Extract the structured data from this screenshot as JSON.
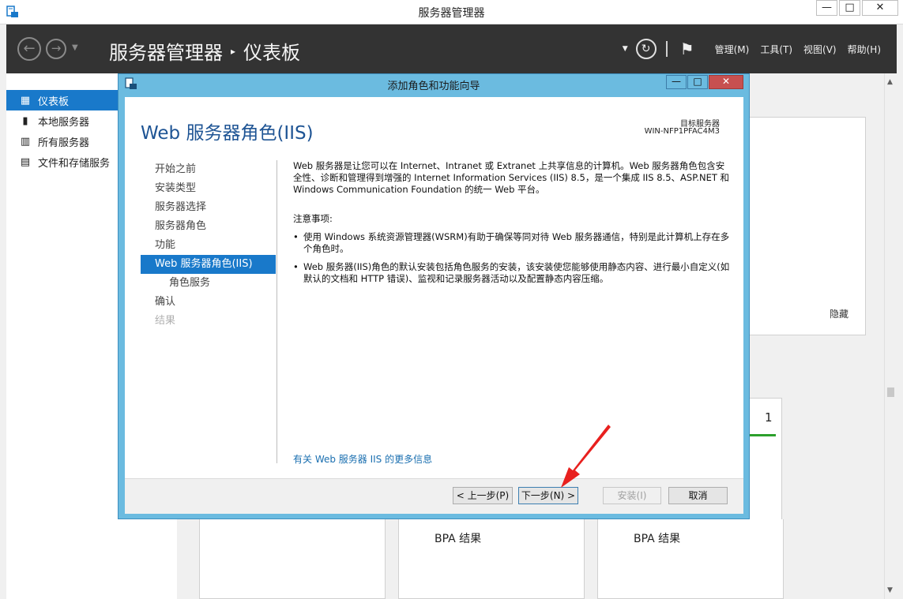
{
  "window": {
    "title": "服务器管理器",
    "minimize": "—",
    "maximize": "□",
    "close": "✕"
  },
  "header": {
    "breadcrumb_root": "服务器管理器",
    "breadcrumb_separator": "▸",
    "breadcrumb_current": "仪表板",
    "menus": [
      "管理(M)",
      "工具(T)",
      "视图(V)",
      "帮助(H)"
    ]
  },
  "sidebar": {
    "items": [
      {
        "label": "仪表板",
        "icon": "dashboard-icon",
        "active": true
      },
      {
        "label": "本地服务器",
        "icon": "server-icon",
        "active": false
      },
      {
        "label": "所有服务器",
        "icon": "servers-icon",
        "active": false
      },
      {
        "label": "文件和存储服务",
        "icon": "storage-icon",
        "active": false
      }
    ]
  },
  "dashboard": {
    "hide_label": "隐藏",
    "tile_count": "1",
    "bpa_label_1": "BPA 结果",
    "bpa_label_2": "BPA 结果"
  },
  "wizard": {
    "title": "添加角色和功能向导",
    "heading": "Web 服务器角色(IIS)",
    "target_label": "目标服务器",
    "target_value": "WIN-NFP1PFAC4M3",
    "steps": [
      {
        "label": "开始之前",
        "state": "normal"
      },
      {
        "label": "安装类型",
        "state": "normal"
      },
      {
        "label": "服务器选择",
        "state": "normal"
      },
      {
        "label": "服务器角色",
        "state": "normal"
      },
      {
        "label": "功能",
        "state": "normal"
      },
      {
        "label": "Web 服务器角色(IIS)",
        "state": "current"
      },
      {
        "label": "角色服务",
        "state": "sub"
      },
      {
        "label": "确认",
        "state": "normal"
      },
      {
        "label": "结果",
        "state": "disabled"
      }
    ],
    "description": "Web 服务器是让您可以在 Internet、Intranet 或 Extranet 上共享信息的计算机。Web 服务器角色包含安全性、诊断和管理得到增强的 Internet Information Services (IIS) 8.5，是一个集成 IIS 8.5、ASP.NET 和 Windows Communication Foundation 的统一 Web 平台。",
    "notes_title": "注意事项:",
    "notes": [
      "使用 Windows 系统资源管理器(WSRM)有助于确保等同对待 Web 服务器通信，特别是此计算机上存在多个角色时。",
      "Web 服务器(IIS)角色的默认安装包括角色服务的安装，该安装使您能够使用静态内容、进行最小自定义(如默认的文档和 HTTP 错误)、监视和记录服务器活动以及配置静态内容压缩。"
    ],
    "more_info_link": "有关 Web 服务器 IIS 的更多信息",
    "buttons": {
      "previous": "< 上一步(P)",
      "next": "下一步(N) >",
      "install": "安装(I)",
      "cancel": "取消"
    }
  },
  "colors": {
    "accent_blue": "#1979ca",
    "header_dark": "#333333",
    "dialog_frame": "#6bbbe0",
    "close_red": "#c75050",
    "annotation_red": "#e8201e"
  }
}
